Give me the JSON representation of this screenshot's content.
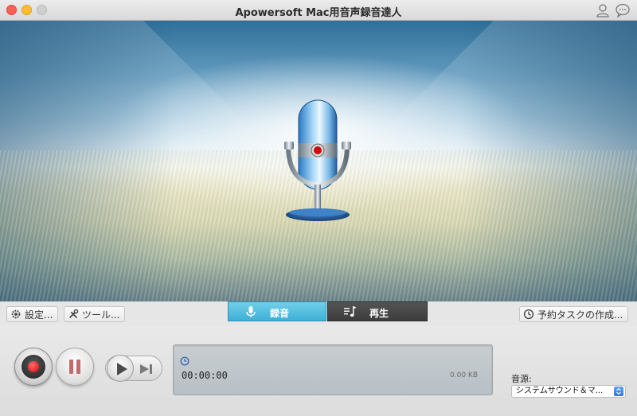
{
  "window": {
    "title": "Apowersoft Mac用音声録音達人"
  },
  "toolbar": {
    "settings_label": "設定...",
    "tools_label": "ツール...",
    "schedule_label": "予約タスクの作成..."
  },
  "tabs": [
    {
      "label": "録音",
      "icon": "microphone-icon",
      "active": true
    },
    {
      "label": "再生",
      "icon": "playlist-icon",
      "active": false
    }
  ],
  "status": {
    "time": "00:00:00",
    "size": "0.00 KB"
  },
  "source": {
    "label": "音源:",
    "value": "システムサウンド＆マ..."
  },
  "colors": {
    "active_tab": "#4fbfe0",
    "inactive_tab": "#474747",
    "record_dot": "#d10a0a"
  }
}
